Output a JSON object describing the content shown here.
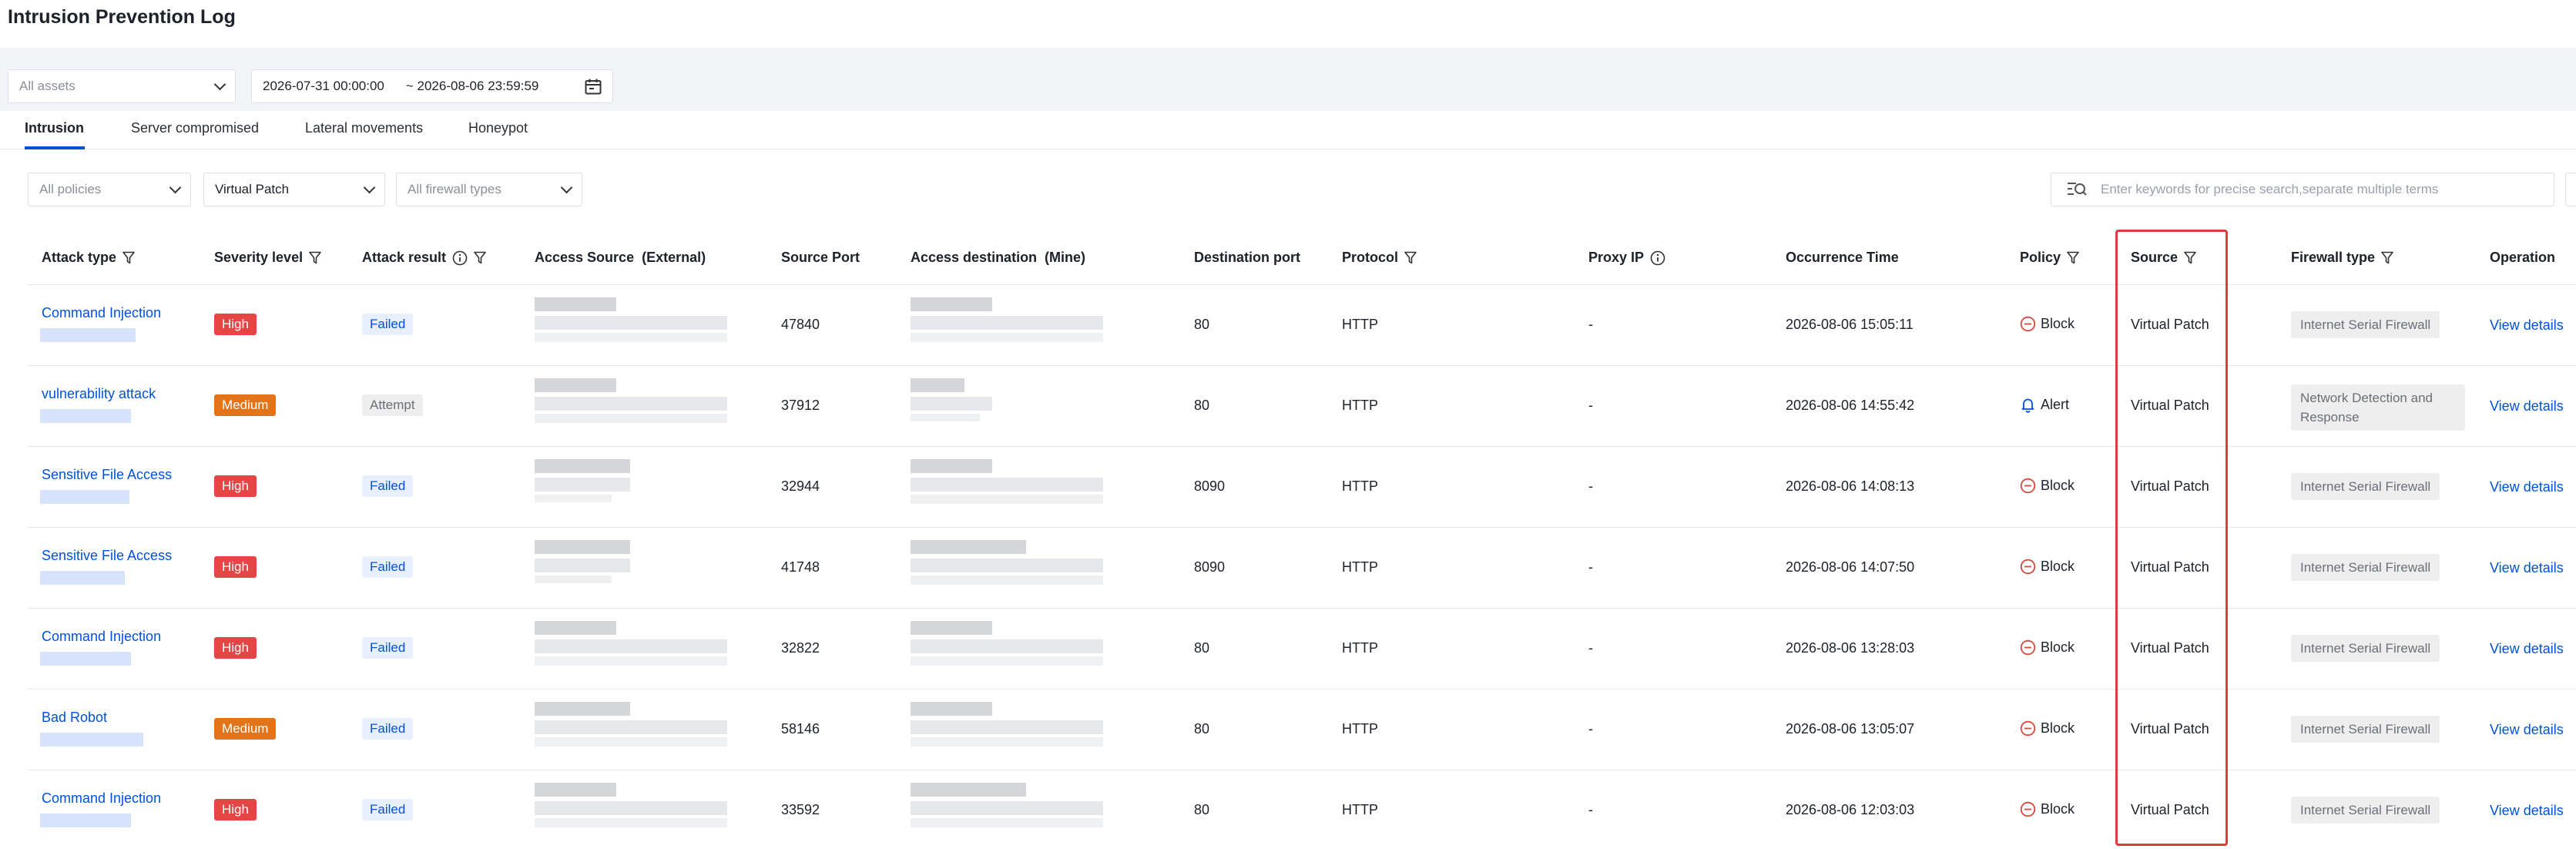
{
  "page": {
    "title": "Intrusion Prevention Log"
  },
  "filters": {
    "assets": "All assets",
    "date_start": "2026-07-31 00:00:00",
    "date_end": "~ 2026-08-06 23:59:59",
    "policies": "All policies",
    "source": "Virtual Patch",
    "firewall_types": "All firewall types",
    "search_placeholder": "Enter keywords for precise search,separate multiple terms"
  },
  "tabs": [
    {
      "label": "Intrusion",
      "active": true
    },
    {
      "label": "Server compromised",
      "active": false
    },
    {
      "label": "Lateral movements",
      "active": false
    },
    {
      "label": "Honeypot",
      "active": false
    }
  ],
  "columns": {
    "attack_type": "Attack type",
    "severity": "Severity level",
    "attack_result": "Attack result",
    "access_source": "Access Source  (External)",
    "source_port": "Source Port",
    "access_dest": "Access destination  (Mine)",
    "dest_port": "Destination port",
    "protocol": "Protocol",
    "proxy_ip": "Proxy IP",
    "occurrence_time": "Occurrence Time",
    "policy": "Policy",
    "source": "Source",
    "firewall_type": "Firewall type",
    "operation": "Operation"
  },
  "colors": {
    "accent": "#0052d9",
    "high": "#e54545",
    "medium": "#e37318",
    "highlight": "#e03a3a"
  },
  "rows": [
    {
      "attack_type": "Command Injection",
      "severity": "High",
      "result": "Failed",
      "source_port": "47840",
      "dest_port": "80",
      "protocol": "HTTP",
      "proxy_ip": "-",
      "time": "2026-08-06 15:05:11",
      "policy": "Block",
      "source": "Virtual Patch",
      "firewall": "Internet Serial Firewall",
      "op": "View details"
    },
    {
      "attack_type": "vulnerability attack",
      "severity": "Medium",
      "result": "Attempt",
      "source_port": "37912",
      "dest_port": "80",
      "protocol": "HTTP",
      "proxy_ip": "-",
      "time": "2026-08-06 14:55:42",
      "policy": "Alert",
      "source": "Virtual Patch",
      "firewall": "Network Detection and Response",
      "op": "View details"
    },
    {
      "attack_type": "Sensitive File Access",
      "severity": "High",
      "result": "Failed",
      "source_port": "32944",
      "dest_port": "8090",
      "protocol": "HTTP",
      "proxy_ip": "-",
      "time": "2026-08-06 14:08:13",
      "policy": "Block",
      "source": "Virtual Patch",
      "firewall": "Internet Serial Firewall",
      "op": "View details"
    },
    {
      "attack_type": "Sensitive File Access",
      "severity": "High",
      "result": "Failed",
      "source_port": "41748",
      "dest_port": "8090",
      "protocol": "HTTP",
      "proxy_ip": "-",
      "time": "2026-08-06 14:07:50",
      "policy": "Block",
      "source": "Virtual Patch",
      "firewall": "Internet Serial Firewall",
      "op": "View details"
    },
    {
      "attack_type": "Command Injection",
      "severity": "High",
      "result": "Failed",
      "source_port": "32822",
      "dest_port": "80",
      "protocol": "HTTP",
      "proxy_ip": "-",
      "time": "2026-08-06 13:28:03",
      "policy": "Block",
      "source": "Virtual Patch",
      "firewall": "Internet Serial Firewall",
      "op": "View details"
    },
    {
      "attack_type": "Bad Robot",
      "severity": "Medium",
      "result": "Failed",
      "source_port": "58146",
      "dest_port": "80",
      "protocol": "HTTP",
      "proxy_ip": "-",
      "time": "2026-08-06 13:05:07",
      "policy": "Block",
      "source": "Virtual Patch",
      "firewall": "Internet Serial Firewall",
      "op": "View details"
    },
    {
      "attack_type": "Command Injection",
      "severity": "High",
      "result": "Failed",
      "source_port": "33592",
      "dest_port": "80",
      "protocol": "HTTP",
      "proxy_ip": "-",
      "time": "2026-08-06 12:03:03",
      "policy": "Block",
      "source": "Virtual Patch",
      "firewall": "Internet Serial Firewall",
      "op": "View details"
    }
  ]
}
